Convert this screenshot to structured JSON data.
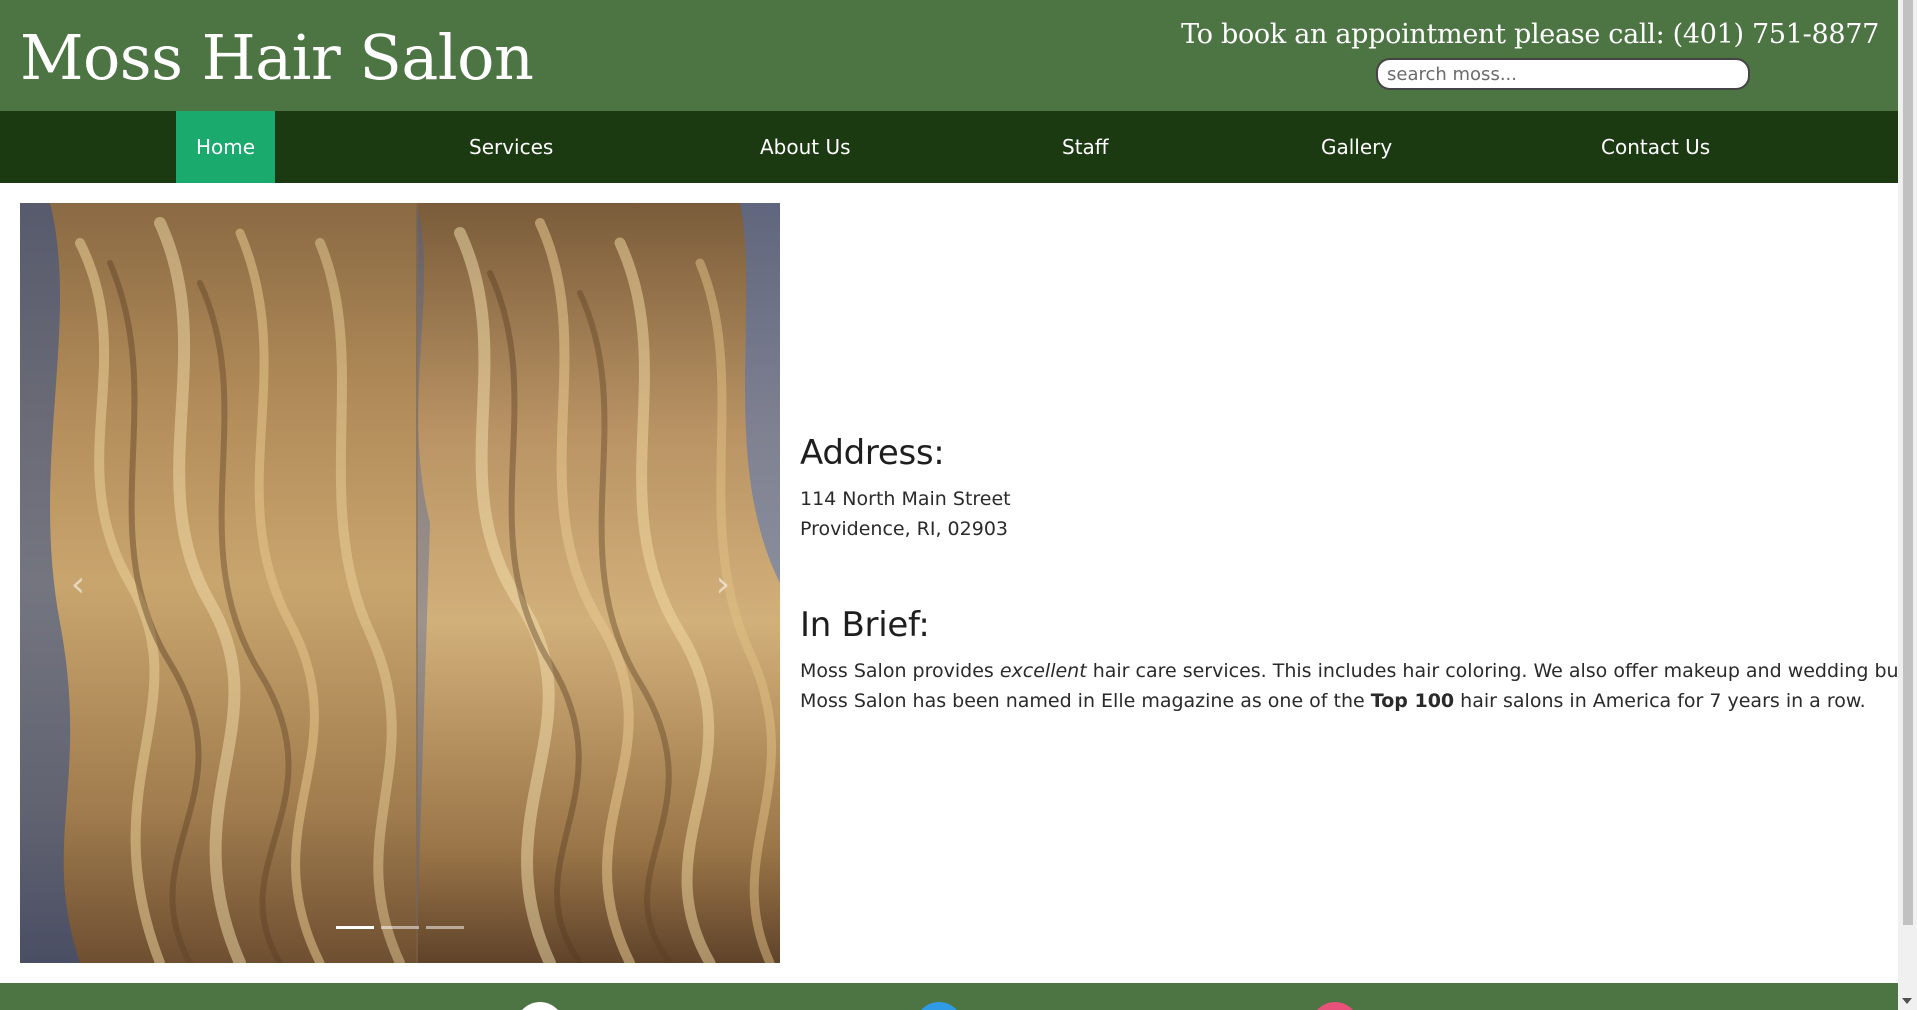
{
  "header": {
    "site_title": "Moss Hair Salon",
    "booking_text": "To book an appointment please call: (401) 751-8877",
    "search_placeholder": "search moss..."
  },
  "nav": {
    "items": [
      {
        "label": "Home",
        "active": true
      },
      {
        "label": "Services",
        "active": false
      },
      {
        "label": "About Us",
        "active": false
      },
      {
        "label": "Staff",
        "active": false
      },
      {
        "label": "Gallery",
        "active": false
      },
      {
        "label": "Contact Us",
        "active": false
      }
    ]
  },
  "carousel": {
    "prev_icon": "chevron-left-icon",
    "next_icon": "chevron-right-icon",
    "slide_count": 3,
    "active_slide": 1
  },
  "address": {
    "heading": "Address:",
    "line1": "114 North Main Street",
    "line2": "Providence, RI, 02903"
  },
  "brief": {
    "heading": "In Brief:",
    "p1_a": "Moss Salon provides ",
    "p1_em": "excellent",
    "p1_b": " hair care services. This includes hair coloring. We also offer makeup and wedding bundles.",
    "p2_a": "Moss Salon has been named in Elle magazine as one of the ",
    "p2_strong": "Top 100",
    "p2_b": " hair salons in America for 7 years in a row."
  },
  "footer": {
    "social_icons": [
      "circle-white-icon",
      "circle-blue-icon",
      "circle-pink-icon"
    ]
  },
  "colors": {
    "header_green": "#4c7543",
    "nav_dark_green": "#1b3a11",
    "nav_active": "#1aaa6e",
    "footer_green": "#4c7543"
  }
}
